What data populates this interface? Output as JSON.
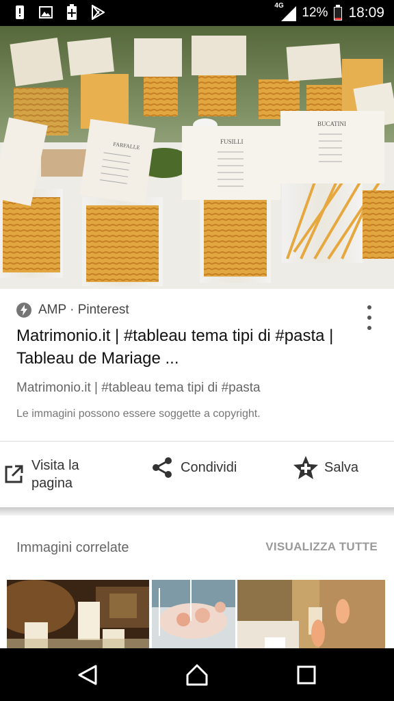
{
  "status_bar": {
    "notifications": [
      "alert-icon",
      "image-icon",
      "battery-saver-icon",
      "play-store-icon"
    ],
    "network": "4G",
    "battery": "12%",
    "time": "18:09"
  },
  "hero": {
    "placards": [
      "FARFALLE",
      "FUSILLI",
      "BUCATINI"
    ]
  },
  "result": {
    "source": "AMP · Pinterest",
    "title": "Matrimonio.it | #tableau tema tipi di #pasta | Tableau de Mariage ...",
    "subtitle": "Matrimonio.it | #tableau tema tipi di #pasta",
    "copyright": "Le immagini possono essere soggette a copyright."
  },
  "actions": {
    "visit_line1": "Visita la",
    "visit_line2": "pagina",
    "share": "Condividi",
    "save": "Salva"
  },
  "related": {
    "title": "Immagini correlate",
    "view_all": "VISUALIZZA TUTTE"
  },
  "nav": [
    "back-icon",
    "home-icon",
    "recents-icon"
  ]
}
